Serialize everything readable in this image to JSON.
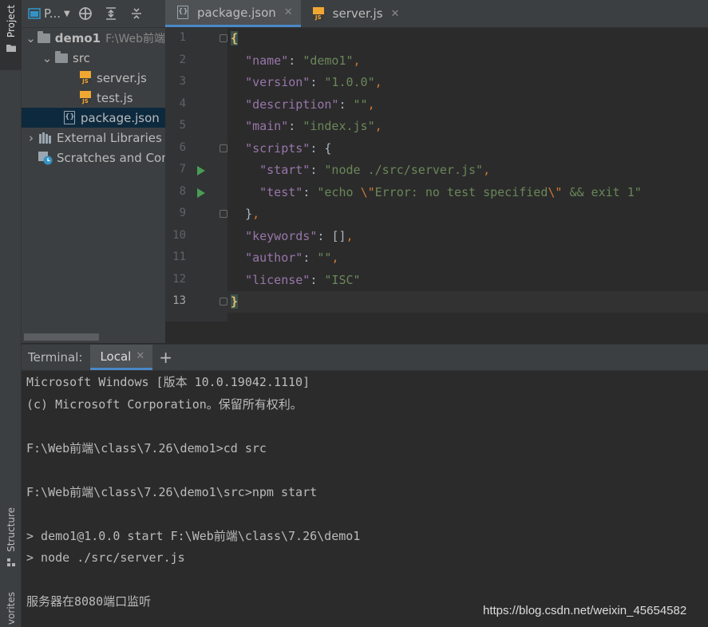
{
  "left_strip": {
    "project_label": "Project",
    "structure_label": "Structure",
    "favorites_label": "vorites"
  },
  "project_panel": {
    "view_selector": "P...",
    "tree": [
      {
        "label": "demo1",
        "hint": "F:\\Web前端",
        "type": "folder",
        "expanded": true
      },
      {
        "label": "src",
        "type": "folder",
        "expanded": true
      },
      {
        "label": "server.js",
        "type": "js"
      },
      {
        "label": "test.js",
        "type": "js"
      },
      {
        "label": "package.json",
        "type": "json",
        "selected": true
      },
      {
        "label": "External Libraries",
        "type": "libraries"
      },
      {
        "label": "Scratches and Con",
        "type": "scratches"
      }
    ]
  },
  "editor": {
    "tabs": [
      {
        "label": "package.json",
        "active": true
      },
      {
        "label": "server.js",
        "active": false
      }
    ],
    "line_numbers": [
      "1",
      "2",
      "3",
      "4",
      "5",
      "6",
      "7",
      "8",
      "9",
      "10",
      "11",
      "12",
      "13"
    ],
    "current_line": 13,
    "code": {
      "l1_brace": "{",
      "l2_key": "\"name\"",
      "l2_val": "\"demo1\"",
      "l3_key": "\"version\"",
      "l3_val": "\"1.0.0\"",
      "l4_key": "\"description\"",
      "l4_val": "\"\"",
      "l5_key": "\"main\"",
      "l5_val": "\"index.js\"",
      "l6_key": "\"scripts\"",
      "l6_brace": "{",
      "l7_key": "\"start\"",
      "l7_val": "\"node ./src/server.js\"",
      "l8_key": "\"test\"",
      "l8_val_a": "\"echo ",
      "l8_esc1": "\\\"",
      "l8_val_b": "Error: no test specified",
      "l8_esc2": "\\\"",
      "l8_val_c": " && exit 1\"",
      "l9_brace": "}",
      "l10_key": "\"keywords\"",
      "l10_val": "[]",
      "l11_key": "\"author\"",
      "l11_val": "\"\"",
      "l12_key": "\"license\"",
      "l12_val": "\"ISC\"",
      "l13_brace": "}"
    }
  },
  "terminal": {
    "title": "Terminal:",
    "tab_label": "Local",
    "lines": [
      "Microsoft Windows [版本 10.0.19042.1110]",
      "(c) Microsoft Corporation。保留所有权利。",
      "",
      "F:\\Web前端\\class\\7.26\\demo1>cd src",
      "",
      "F:\\Web前端\\class\\7.26\\demo1\\src>npm start",
      "",
      "> demo1@1.0.0 start F:\\Web前端\\class\\7.26\\demo1",
      "> node ./src/server.js",
      "",
      "服务器在8080端口监听"
    ],
    "watermark": "https://blog.csdn.net/weixin_45654582"
  },
  "colors": {
    "accent": "#4a88c7",
    "key": "#9876aa",
    "string": "#6a8759",
    "punct": "#cc7832",
    "run_gutter": "#499c54"
  }
}
